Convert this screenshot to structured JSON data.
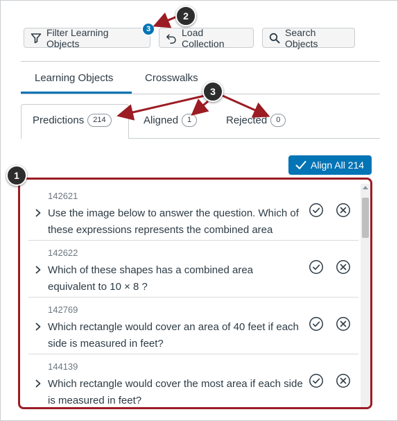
{
  "toolbar": {
    "filter_label": "Filter Learning Objects",
    "filter_badge": "3",
    "load_label": "Load Collection",
    "search_label": "Search Objects"
  },
  "tabs": [
    {
      "label": "Learning Objects",
      "selected": true
    },
    {
      "label": "Crosswalks",
      "selected": false
    }
  ],
  "subtabs": [
    {
      "label": "Predictions",
      "count": "214",
      "selected": true
    },
    {
      "label": "Aligned",
      "count": "1",
      "selected": false
    },
    {
      "label": "Rejected",
      "count": "0",
      "selected": false
    }
  ],
  "align_all_label": "Align All 214",
  "items": [
    {
      "id": "142621",
      "text": "Use the image below to answer the question. Which of these expressions represents the combined area"
    },
    {
      "id": "142622",
      "text": "Which of these shapes has a combined area equivalent to 10 × 8 ?"
    },
    {
      "id": "142769",
      "text": "Which rectangle would cover an area of 40 feet if each side is measured in feet?"
    },
    {
      "id": "144139",
      "text": "Which rectangle would cover the most area if each side is measured in feet?"
    }
  ],
  "callouts": {
    "one": "1",
    "two": "2",
    "three": "3"
  },
  "colors": {
    "accent": "#0374b5",
    "callout_border": "#9b1c23",
    "callout_bg": "#2d2d2d"
  }
}
